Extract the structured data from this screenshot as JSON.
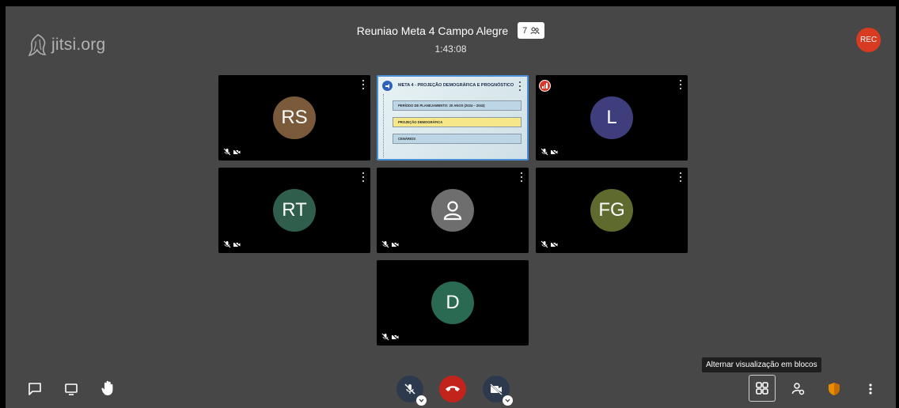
{
  "logo": {
    "text": "jitsi.org"
  },
  "header": {
    "title": "Reuniao Meta 4 Campo Alegre",
    "participant_count": "7",
    "timer": "1:43:08"
  },
  "recording": {
    "label": "REC",
    "color": "#d83b1f"
  },
  "tiles": [
    {
      "initials": "RS",
      "color": "#7a5a3a"
    },
    {
      "type": "screen-share"
    },
    {
      "initials": "L",
      "color": "#3e3e7c"
    },
    {
      "initials": "RT",
      "color": "#2f5f4c"
    },
    {
      "type": "no-avatar"
    },
    {
      "initials": "FG",
      "color": "#5e6a2e"
    },
    {
      "initials": "D",
      "color": "#2a6a52"
    }
  ],
  "slide": {
    "title": "META 4 - PROJEÇÃO DEMOGRÁFICA E PROGNÓSTICO",
    "items": [
      "PERÍODO DE PLANEJAMENTO: 20 ANOS (2024 – 2043)",
      "PROJEÇÃO DEMOGRÁFICA",
      "CENÁRIOS"
    ]
  },
  "toolbar": {
    "tooltip": "Alternar visualização em blocos",
    "accent_red": "#c2241b",
    "accent_orange": "#e98c00"
  }
}
